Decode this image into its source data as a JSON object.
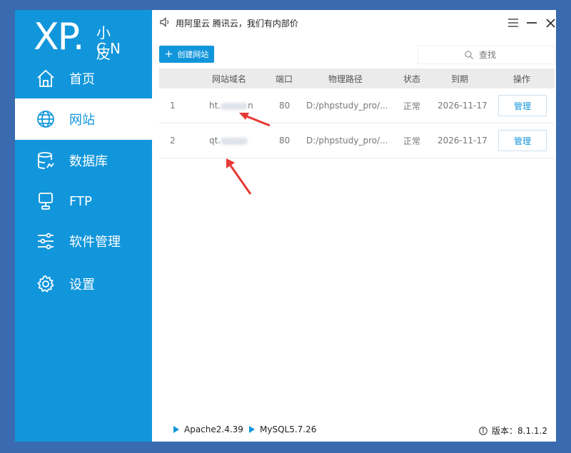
{
  "logo": {
    "mark": "XP.",
    "sub": "小皮",
    "cn": "CN"
  },
  "nav": [
    {
      "label": "首页",
      "icon": "home-icon"
    },
    {
      "label": "网站",
      "icon": "globe-icon"
    },
    {
      "label": "数据库",
      "icon": "database-icon"
    },
    {
      "label": "FTP",
      "icon": "server-icon"
    },
    {
      "label": "软件管理",
      "icon": "sliders-icon"
    },
    {
      "label": "设置",
      "icon": "gear-icon"
    }
  ],
  "topbar": {
    "notice": "用阿里云 腾讯云，我们有内部价"
  },
  "toolbar": {
    "create_label": "创建网站",
    "search_placeholder": "查找"
  },
  "table": {
    "headers": [
      "网站域名",
      "端口",
      "物理路径",
      "状态",
      "到期",
      "操作"
    ],
    "rows": [
      {
        "index": "1",
        "domain": "ht.",
        "domain_tail": "n",
        "port": "80",
        "path": "D:/phpstudy_pro/...",
        "status": "正常",
        "expiry": "2026-11-17",
        "action": "管理"
      },
      {
        "index": "2",
        "domain": "qt.",
        "domain_tail": "",
        "port": "80",
        "path": "D:/phpstudy_pro/...",
        "status": "正常",
        "expiry": "2026-11-17",
        "action": "管理"
      }
    ]
  },
  "footer": {
    "apache": "Apache2.4.39",
    "mysql": "MySQL5.7.26",
    "version": "版本：8.1.1.2"
  },
  "colors": {
    "accent": "#1296db",
    "arrow": "#e53935"
  }
}
